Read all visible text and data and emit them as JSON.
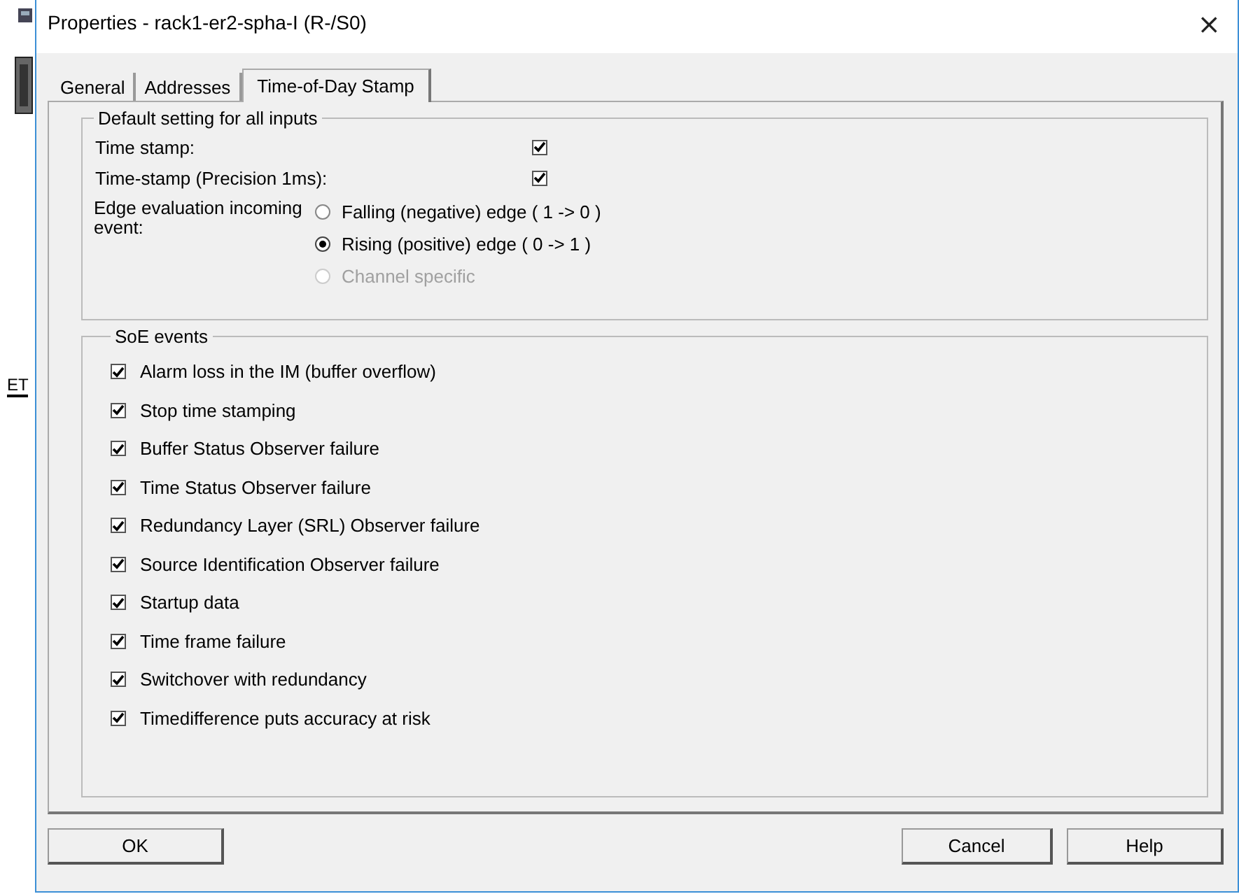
{
  "background": {
    "text": "ET"
  },
  "window": {
    "title": "Properties - rack1-er2-spha-I (R-/S0)",
    "close": "×"
  },
  "tabs": [
    {
      "label": "General",
      "selected": false
    },
    {
      "label": "Addresses",
      "selected": false
    },
    {
      "label": "Time-of-Day Stamp",
      "selected": true
    }
  ],
  "default_group": {
    "title": "Default setting for all inputs",
    "checkboxes": [
      {
        "label": "Time stamp:",
        "checked": true
      },
      {
        "label": "Time-stamp (Precision 1ms):",
        "checked": true
      }
    ],
    "edge_label": "Edge evaluation incoming event:",
    "edge_options": [
      {
        "label": "Falling (negative) edge ( 1 -> 0 )",
        "selected": false,
        "disabled": false
      },
      {
        "label": "Rising (positive) edge ( 0 -> 1 )",
        "selected": true,
        "disabled": false
      },
      {
        "label": "Channel specific",
        "selected": false,
        "disabled": true
      }
    ]
  },
  "soe_group": {
    "title": "SoE events",
    "items": [
      {
        "label": "Alarm loss in the IM (buffer overflow)",
        "checked": true
      },
      {
        "label": "Stop time stamping",
        "checked": true
      },
      {
        "label": "Buffer Status Observer failure",
        "checked": true
      },
      {
        "label": "Time Status Observer failure",
        "checked": true
      },
      {
        "label": "Redundancy Layer (SRL) Observer failure",
        "checked": true
      },
      {
        "label": "Source Identification Observer failure",
        "checked": true
      },
      {
        "label": "Startup data",
        "checked": true
      },
      {
        "label": "Time frame failure",
        "checked": true
      },
      {
        "label": "Switchover with redundancy",
        "checked": true
      },
      {
        "label": "Timedifference puts accuracy at risk",
        "checked": true
      }
    ]
  },
  "buttons": [
    {
      "label": "OK"
    },
    {
      "label": "Cancel"
    },
    {
      "label": "Help"
    }
  ]
}
